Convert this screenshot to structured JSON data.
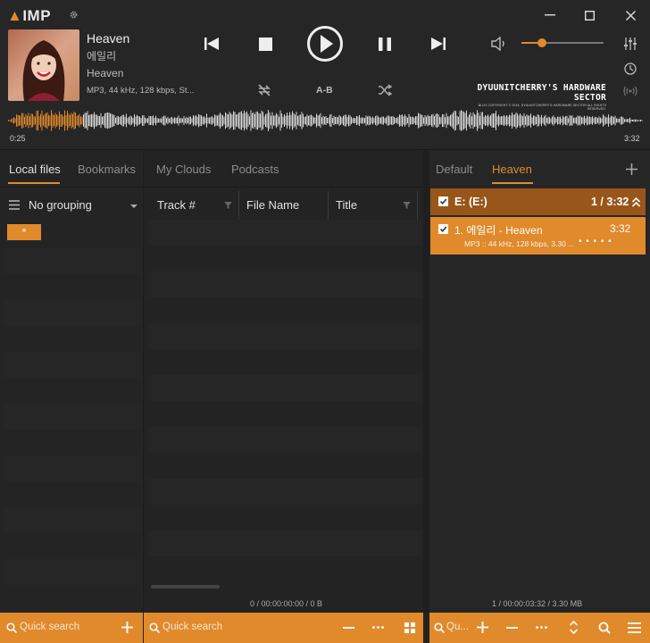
{
  "app": {
    "logo_text": "IMP"
  },
  "now_playing": {
    "title": "Heaven",
    "artist": "에일리",
    "album": "Heaven",
    "info": "MP3, 44 kHz, 128 kbps, St...",
    "elapsed": "0:25",
    "duration": "3:32",
    "progress": 0.118,
    "volume": 0.25
  },
  "controls": {
    "ab_label": "A-B"
  },
  "banner": {
    "title": "DYUUNITCHERRY'S HARDWARE SECTOR",
    "subtitle": "BLOG COPYRIGHT © 2015. DYUUNITCHERRY'S HARDWARE SECTOR ALL RIGHTS RESERVED."
  },
  "left_tabs": [
    "Local files",
    "Bookmarks",
    "My Clouds",
    "Podcasts"
  ],
  "grouping": {
    "label": "No grouping",
    "filter_chip": "*"
  },
  "columns": [
    "Track #",
    "File Name",
    "Title"
  ],
  "middle_status": "0 / 00:00:00:00 / 0 B",
  "right_tabs": [
    "Default",
    "Heaven"
  ],
  "playlist": {
    "group_label": "E: (E:)",
    "group_count": "1 / 3:32",
    "track_title": "1. 에일리 - Heaven",
    "track_duration": "3:32",
    "track_info": "MP3 :: 44 kHz, 128 kbps, 3.30 ...",
    "track_rating": "• • • • •",
    "status": "1 / 00:00:03:32 / 3.30 MB"
  },
  "footer": {
    "left_search": "Quick search",
    "mid_search": "Quick search",
    "right_search": "Qu..."
  },
  "colors": {
    "accent": "#e08a2c",
    "background": "#232323"
  }
}
